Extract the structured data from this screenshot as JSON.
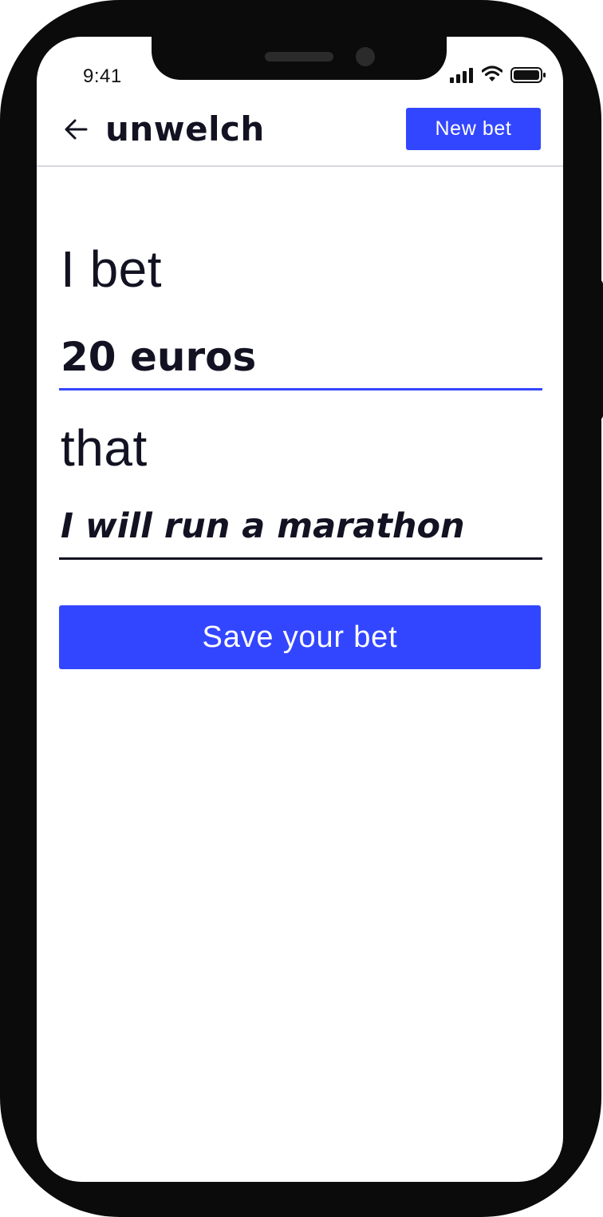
{
  "status_bar": {
    "time": "9:41",
    "icons": [
      "cellular-signal-icon",
      "wifi-icon",
      "battery-icon"
    ]
  },
  "header": {
    "back_icon": "arrow-left-icon",
    "app_name": "unwelch",
    "new_bet_label": "New bet"
  },
  "bet_form": {
    "prefix_label": "I bet",
    "amount_value": "20 euros",
    "connector_label": "that",
    "claim_value": "I will run a marathon",
    "save_label": "Save your bet"
  },
  "colors": {
    "accent": "#3346ff",
    "text": "#121222",
    "frame": "#0b0b0b",
    "divider": "#d8d8de"
  }
}
